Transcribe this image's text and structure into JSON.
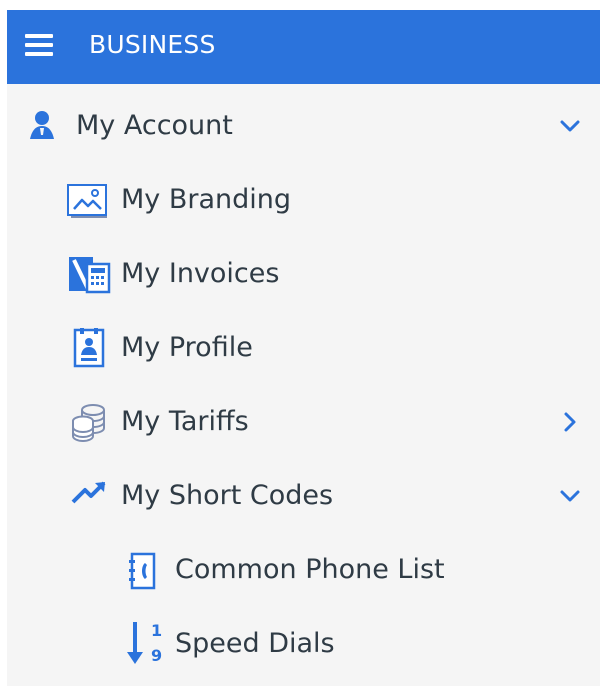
{
  "header": {
    "title": "BUSINESS",
    "menu_icon": "hamburger-icon",
    "background": "#2b73dc"
  },
  "menu": {
    "account": {
      "label": "My Account",
      "icon": "user-icon",
      "state": "expanded"
    },
    "branding": {
      "label": "My Branding",
      "icon": "image-icon"
    },
    "invoices": {
      "label": "My Invoices",
      "icon": "invoice-calculator-icon"
    },
    "profile": {
      "label": "My Profile",
      "icon": "profile-card-icon"
    },
    "tariffs": {
      "label": "My Tariffs",
      "icon": "coins-icon",
      "state": "collapsed"
    },
    "short_codes": {
      "label": "My Short Codes",
      "icon": "trend-icon",
      "state": "expanded"
    },
    "common_phone_list": {
      "label": "Common Phone List",
      "icon": "phone-book-icon"
    },
    "speed_dials": {
      "label": "Speed Dials",
      "icon": "sort-numeric-icon"
    }
  },
  "colors": {
    "accent": "#2b73dc",
    "text": "#2f3b45",
    "panel": "#f5f5f5"
  }
}
